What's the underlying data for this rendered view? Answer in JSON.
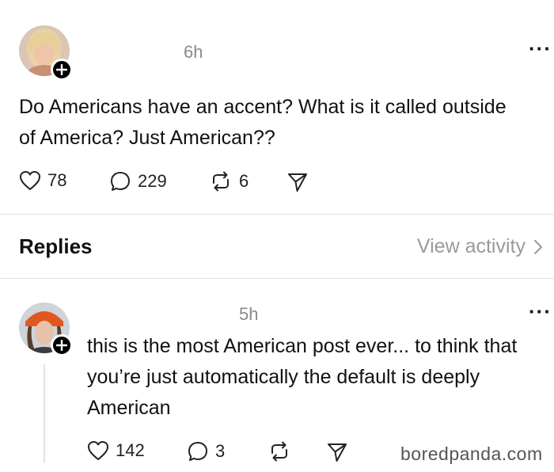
{
  "post": {
    "time": "6h",
    "text": "Do Americans have an accent? What is it called outside of America? Just American??",
    "likes": "78",
    "comments": "229",
    "reposts": "6"
  },
  "replies_header": {
    "title": "Replies",
    "view_activity": "View activity"
  },
  "reply": {
    "time": "5h",
    "text": "this is the most American post ever... to think that you’re just automatically the default is deeply American",
    "likes": "142",
    "comments": "3"
  },
  "watermark": "boredpanda.com",
  "icons": [
    "heart-icon",
    "comment-icon",
    "repost-icon",
    "share-icon",
    "more-icon",
    "plus-icon",
    "chevron-right-icon"
  ]
}
